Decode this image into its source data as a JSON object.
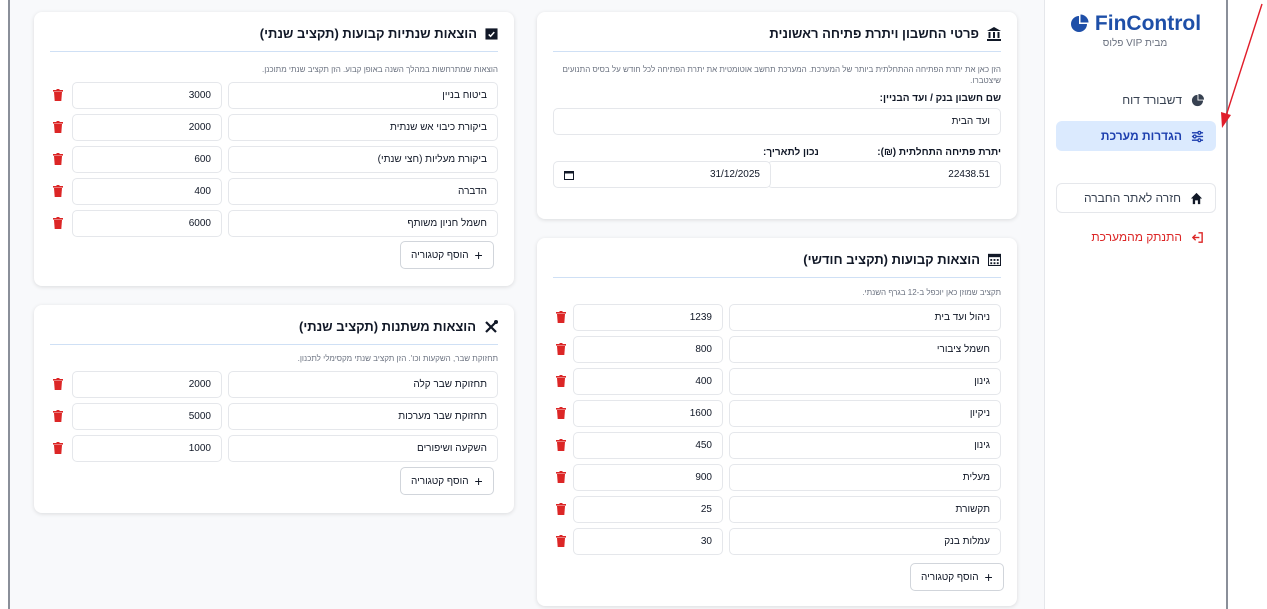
{
  "brand": {
    "name": "FinControl",
    "subtitle": "מבית VIP פלוס"
  },
  "nav": [
    {
      "label": "דשבורד דוח",
      "icon": "pie-chart-icon"
    },
    {
      "label": "הגדרות מערכת",
      "icon": "sliders-icon"
    },
    {
      "label": "חזרה לאתר החברה",
      "icon": "home-icon"
    },
    {
      "label": "התנתק מהמערכת",
      "icon": "logout-icon"
    }
  ],
  "opening": {
    "title": "פרטי החשבון ויתרת פתיחה ראשונית",
    "desc": "הזן כאן את יתרת הפתיחה ההתחלתית ביותר של המערכת. המערכת תחשב אוטומטית את יתרת הפתיחה לכל חודש על בסיס התנועים שיצטברו.",
    "account_label": "שם חשבון בנק / ועד הבניין:",
    "account_value": "ועד הבית",
    "balance_label": "יתרת פתיחה התחלתית (₪):",
    "balance_value": "22438.51",
    "date_label": "נכון לתאריך:",
    "date_value": "31/12/2025"
  },
  "monthly": {
    "title": "הוצאות קבועות (תקציב חודשי)",
    "desc": "תקציב שמוזן כאן יוכפל ב-12 בגרף השנתי.",
    "add_label": "הוסף קטגוריה",
    "rows": [
      {
        "name": "ניהול ועד בית",
        "amount": "1239"
      },
      {
        "name": "חשמל ציבורי",
        "amount": "800"
      },
      {
        "name": "גינון",
        "amount": "400"
      },
      {
        "name": "ניקיון",
        "amount": "1600"
      },
      {
        "name": "גינון",
        "amount": "450"
      },
      {
        "name": "מעלית",
        "amount": "900"
      },
      {
        "name": "תקשורת",
        "amount": "25"
      },
      {
        "name": "עמלות בנק",
        "amount": "30"
      }
    ]
  },
  "annual_fixed": {
    "title": "הוצאות שנתיות קבועות (תקציב שנתי)",
    "desc": "הוצאות שמתרחשות במהלך השנה באופן קבוע. הזן תקציב שנתי מתוכנן.",
    "add_label": "הוסף קטגוריה",
    "rows": [
      {
        "name": "ביטוח בניין",
        "amount": "3000"
      },
      {
        "name": "ביקורת כיבוי אש שנתית",
        "amount": "2000"
      },
      {
        "name": "ביקורת מעליות (חצי שנתי)",
        "amount": "600"
      },
      {
        "name": "הדברה",
        "amount": "400"
      },
      {
        "name": "חשמל חניון משותף",
        "amount": "6000"
      }
    ]
  },
  "variable": {
    "title": "הוצאות משתנות (תקציב שנתי)",
    "desc": "תחזוקת שבר, השקעות וכו'. הזן תקציב שנתי מקסימלי לתכנון.",
    "add_label": "הוסף קטגוריה",
    "rows": [
      {
        "name": "תחזוקת שבר קלה",
        "amount": "2000"
      },
      {
        "name": "תחזוקת שבר מערכות",
        "amount": "5000"
      },
      {
        "name": "השקעה ושיפורים",
        "amount": "1000"
      }
    ]
  },
  "colors": {
    "brand": "#1e4fa8",
    "active_bg": "#dbeafe",
    "trash": "#dc2626",
    "annotation": "#e11d2a"
  }
}
